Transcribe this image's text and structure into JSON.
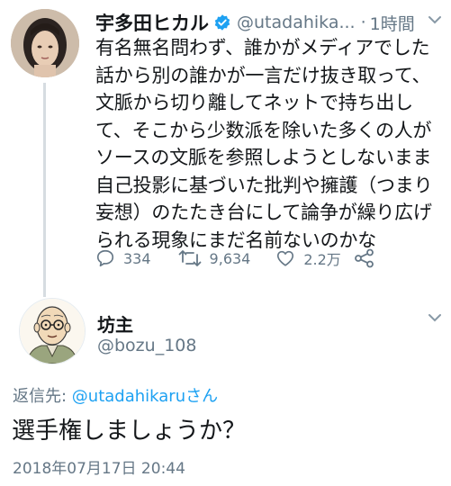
{
  "original_tweet": {
    "display_name": "宇多田ヒカル",
    "handle": "@utadahika...",
    "separator": "·",
    "time": "1時間",
    "body_lines": [
      "有名無名問わず、誰かがメディアでした",
      "話から別の誰かが一言だけ抜き取って、",
      "文脈から切り離してネットで持ち出し",
      "て、そこから少数派を除いた多くの人が",
      "ソースの文脈を参照しようとしないまま",
      "自己投影に基づいた批判や擁護（つまり",
      "妄想）のたたき台にして論争が繰り広げ",
      "られる現象にまだ名前ないのかな"
    ],
    "replies": "334",
    "retweets": "9,634",
    "likes": "2.2万"
  },
  "reply_tweet": {
    "display_name": "坊主",
    "handle": "@bozu_108",
    "replying_prefix": "返信先: ",
    "replying_mention": "@utadahikaru",
    "replying_suffix": "さん",
    "text": "選手権しましょうか？",
    "datetime": "2018年07月17日 20:44"
  },
  "colors": {
    "text": "#14171a",
    "secondary": "#657786",
    "link": "#1da1f2",
    "verified": "#1da1f2"
  }
}
